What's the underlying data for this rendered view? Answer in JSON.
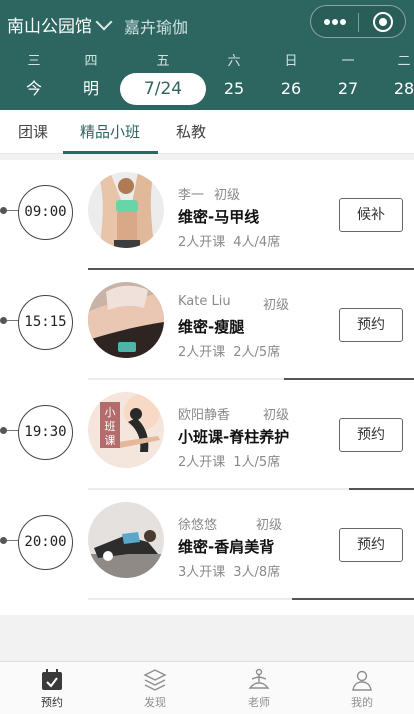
{
  "header": {
    "venue": "南山公园馆",
    "subtitle": "嘉卉瑜伽",
    "icons": [
      "more-dots-icon",
      "close-target-icon"
    ]
  },
  "calendar": {
    "weekdays": [
      "三",
      "四",
      "五",
      "六",
      "日",
      "一",
      "二"
    ],
    "dates": [
      "今",
      "明",
      "7/24",
      "25",
      "26",
      "27",
      "28"
    ],
    "selected_index": 2
  },
  "tabs": [
    {
      "label": "团课"
    },
    {
      "label": "精品小班"
    },
    {
      "label": "私教"
    }
  ],
  "active_tab": 1,
  "classes": [
    {
      "time": "09:00",
      "teacher": "李一",
      "level": "初级",
      "name": "维密-马甲线",
      "open": "2人开课",
      "enrolled": "4人/4席",
      "action": "候补",
      "progress": 1.0
    },
    {
      "time": "15:15",
      "teacher": "Kate Liu",
      "level": "初级",
      "name": "维密-瘦腿",
      "open": "2人开课",
      "enrolled": "2人/5席",
      "action": "预约",
      "progress": 0.4
    },
    {
      "time": "19:30",
      "teacher": "欧阳静香",
      "level": "初级",
      "name": "小班课-脊柱养护",
      "open": "2人开课",
      "enrolled": "1人/5席",
      "action": "预约",
      "progress": 0.2,
      "badge": "小班课"
    },
    {
      "time": "20:00",
      "teacher": "徐悠悠",
      "level": "初级",
      "name": "维密-香肩美背",
      "open": "3人开课",
      "enrolled": "3人/8席",
      "action": "预约",
      "progress": 0.375
    }
  ],
  "tabbar": [
    {
      "label": "预约",
      "icon": "calendar-icon",
      "active": true
    },
    {
      "label": "发现",
      "icon": "layers-icon",
      "active": false
    },
    {
      "label": "老师",
      "icon": "meditation-icon",
      "active": false
    },
    {
      "label": "我的",
      "icon": "user-icon",
      "active": false
    }
  ],
  "colors": {
    "primary": "#2d6560",
    "bg": "#f2f2f2"
  }
}
